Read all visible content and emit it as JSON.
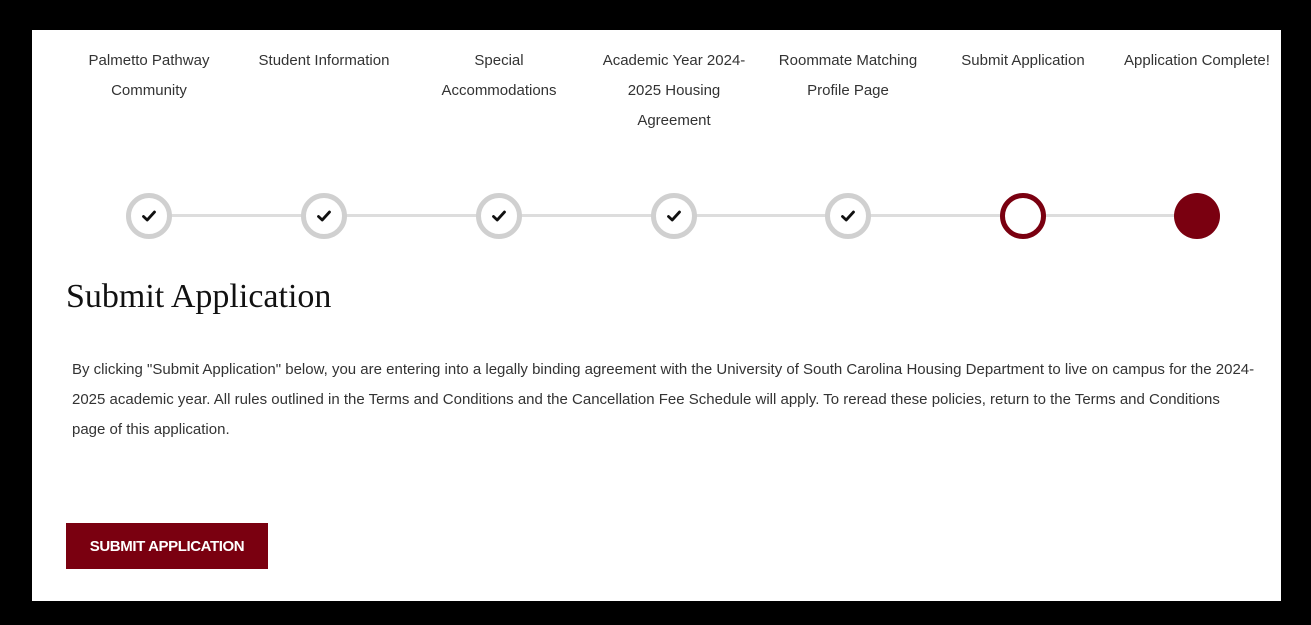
{
  "progress": {
    "steps": [
      {
        "label": "Palmetto Pathway Community",
        "state": "done"
      },
      {
        "label": "Student Information",
        "state": "done"
      },
      {
        "label": "Special Accommodations",
        "state": "done"
      },
      {
        "label": "Academic Year 2024-2025 Housing Agreement",
        "state": "done"
      },
      {
        "label": "Roommate Matching Profile Page",
        "state": "done"
      },
      {
        "label": "Submit Application",
        "state": "current"
      },
      {
        "label": "Application Complete!",
        "state": "todo"
      }
    ],
    "icons": {
      "done": "check-icon"
    }
  },
  "main": {
    "title": "Submit Application",
    "agreement_text": "By clicking \"Submit Application\" below, you are entering into a legally binding agreement with the University of South Carolina Housing Department to live on campus for the 2024-2025 academic year. All rules outlined in the Terms and Conditions and the Cancellation Fee Schedule will apply. To reread these policies, return to the Terms and Conditions page of this application.",
    "submit_label": "SUBMIT APPLICATION"
  },
  "colors": {
    "accent": "#7a0010",
    "done_ring": "#d0d0d0",
    "track": "#dddddd",
    "frame": "#000000"
  }
}
